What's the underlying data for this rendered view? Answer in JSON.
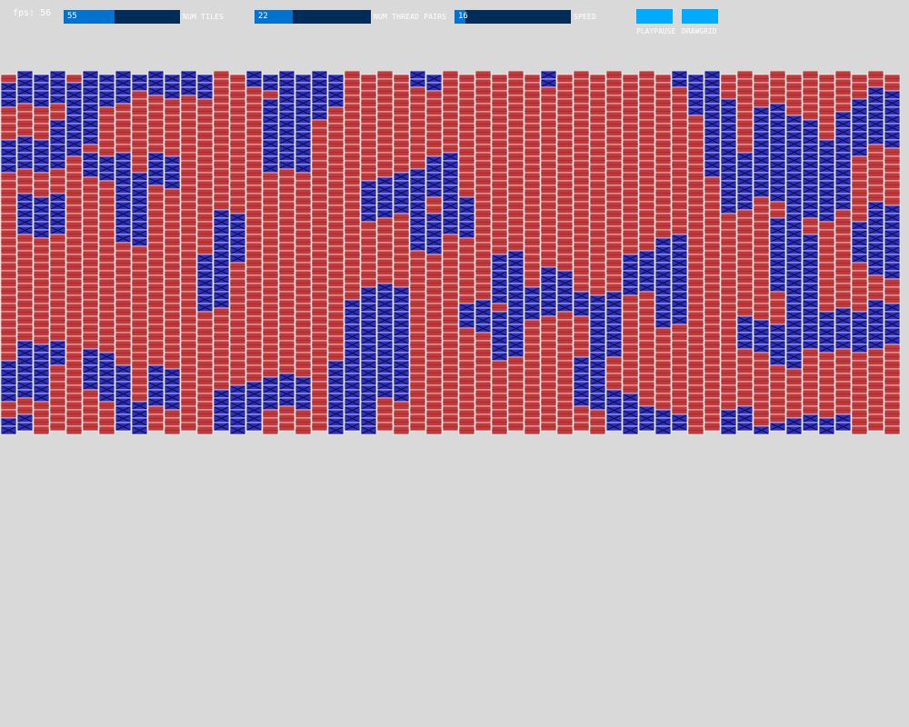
{
  "fps_label": "fps: 56",
  "sliders": [
    {
      "id": "num-tiles",
      "value": "55",
      "fraction": 0.44,
      "label": "NUM TILES"
    },
    {
      "id": "num-thread-pairs",
      "value": "22",
      "fraction": 0.33,
      "label": "NUM THREAD PAIRS"
    },
    {
      "id": "speed",
      "value": "16",
      "fraction": 0.09,
      "label": "SPEED"
    }
  ],
  "buttons": [
    {
      "id": "playpause",
      "label": "PLAYPAUSE"
    },
    {
      "id": "drawgrid",
      "label": "DRAWGRID"
    }
  ],
  "colors": {
    "background": "#d9d9d9",
    "slider_track": "#002c5a",
    "slider_fill": "#0073d1",
    "button": "#00aaff",
    "warp_red": "#c0393b",
    "weft_blue": "#2d2dc8",
    "cell_border": "#ffffff",
    "cross_line": "#111133"
  },
  "weave": {
    "columns": 55,
    "rows": 44,
    "blue_regions": [
      [
        0,
        4,
        1,
        3
      ],
      [
        0,
        3,
        8,
        11
      ],
      [
        0,
        2,
        35,
        39
      ],
      [
        0,
        1,
        42,
        44
      ],
      [
        1,
        3,
        0,
        2
      ],
      [
        1,
        3,
        15,
        19
      ],
      [
        1,
        3,
        33,
        35
      ],
      [
        1,
        1,
        43,
        44
      ],
      [
        3,
        4,
        6,
        9
      ],
      [
        4,
        5,
        4,
        8
      ],
      [
        5,
        7,
        0,
        3
      ],
      [
        5,
        7,
        10,
        12
      ],
      [
        5,
        6,
        34,
        38
      ],
      [
        6,
        7,
        36,
        39
      ],
      [
        5,
        5,
        1,
        3
      ],
      [
        7,
        8,
        0,
        1
      ],
      [
        7,
        8,
        12,
        20
      ],
      [
        7,
        8,
        40,
        44
      ],
      [
        9,
        10,
        0,
        2
      ],
      [
        9,
        10,
        10,
        13
      ],
      [
        9,
        10,
        36,
        40
      ],
      [
        11,
        12,
        0,
        2
      ],
      [
        12,
        13,
        22,
        28
      ],
      [
        13,
        14,
        17,
        22
      ],
      [
        13,
        14,
        39,
        43
      ],
      [
        14,
        15,
        38,
        44
      ],
      [
        15,
        16,
        0,
        1
      ],
      [
        16,
        18,
        3,
        11
      ],
      [
        16,
        18,
        37,
        40
      ],
      [
        17,
        18,
        0,
        4
      ],
      [
        18,
        19,
        2,
        5
      ],
      [
        19,
        20,
        0,
        3
      ],
      [
        20,
        22,
        35,
        44
      ],
      [
        21,
        22,
        28,
        34
      ],
      [
        22,
        23,
        13,
        17
      ],
      [
        22,
        24,
        26,
        33
      ],
      [
        23,
        24,
        33,
        39
      ],
      [
        23,
        24,
        31,
        36
      ],
      [
        24,
        25,
        12,
        16
      ],
      [
        24,
        25,
        44,
        44
      ],
      [
        25,
        26,
        17,
        21
      ],
      [
        25,
        26,
        0,
        1
      ],
      [
        26,
        27,
        10,
        14
      ],
      [
        27,
        28,
        15,
        19
      ],
      [
        28,
        29,
        28,
        30
      ],
      [
        29,
        30,
        29,
        31
      ],
      [
        30,
        31,
        22,
        27
      ],
      [
        30,
        31,
        29,
        34
      ],
      [
        31,
        32,
        27,
        29
      ],
      [
        32,
        33,
        26,
        29
      ],
      [
        33,
        33,
        0,
        1
      ],
      [
        33,
        34,
        24,
        28
      ],
      [
        35,
        36,
        35,
        40
      ],
      [
        35,
        37,
        27,
        29
      ],
      [
        36,
        37,
        28,
        34
      ],
      [
        37,
        38,
        39,
        43
      ],
      [
        38,
        39,
        22,
        26
      ],
      [
        38,
        39,
        43,
        44
      ],
      [
        39,
        40,
        41,
        44
      ],
      [
        40,
        41,
        20,
        30
      ],
      [
        40,
        41,
        42,
        44
      ],
      [
        42,
        43,
        0,
        1
      ],
      [
        41,
        42,
        0,
        1
      ],
      [
        42,
        43,
        2,
        4
      ],
      [
        43,
        44,
        3,
        12
      ],
      [
        44,
        45,
        12,
        16
      ],
      [
        45,
        46,
        10,
        14
      ],
      [
        46,
        47,
        4,
        13
      ],
      [
        47,
        48,
        5,
        15
      ],
      [
        47,
        48,
        18,
        26
      ],
      [
        48,
        49,
        6,
        17
      ],
      [
        48,
        49,
        20,
        30
      ],
      [
        49,
        50,
        8,
        17
      ],
      [
        49,
        50,
        29,
        33
      ],
      [
        50,
        51,
        8,
        16
      ],
      [
        50,
        51,
        30,
        33
      ],
      [
        51,
        52,
        5,
        9
      ],
      [
        51,
        52,
        29,
        32
      ],
      [
        52,
        53,
        3,
        8
      ],
      [
        52,
        53,
        18,
        22
      ],
      [
        53,
        54,
        2,
        6
      ],
      [
        53,
        54,
        16,
        24
      ],
      [
        54,
        55,
        5,
        8
      ],
      [
        54,
        55,
        18,
        22
      ],
      [
        52,
        53,
        30,
        33
      ],
      [
        53,
        54,
        28,
        32
      ],
      [
        45,
        46,
        30,
        33
      ],
      [
        47,
        48,
        31,
        35
      ],
      [
        48,
        49,
        42,
        44
      ],
      [
        50,
        51,
        42,
        44
      ],
      [
        44,
        45,
        41,
        43
      ],
      [
        46,
        47,
        43,
        44
      ]
    ]
  }
}
